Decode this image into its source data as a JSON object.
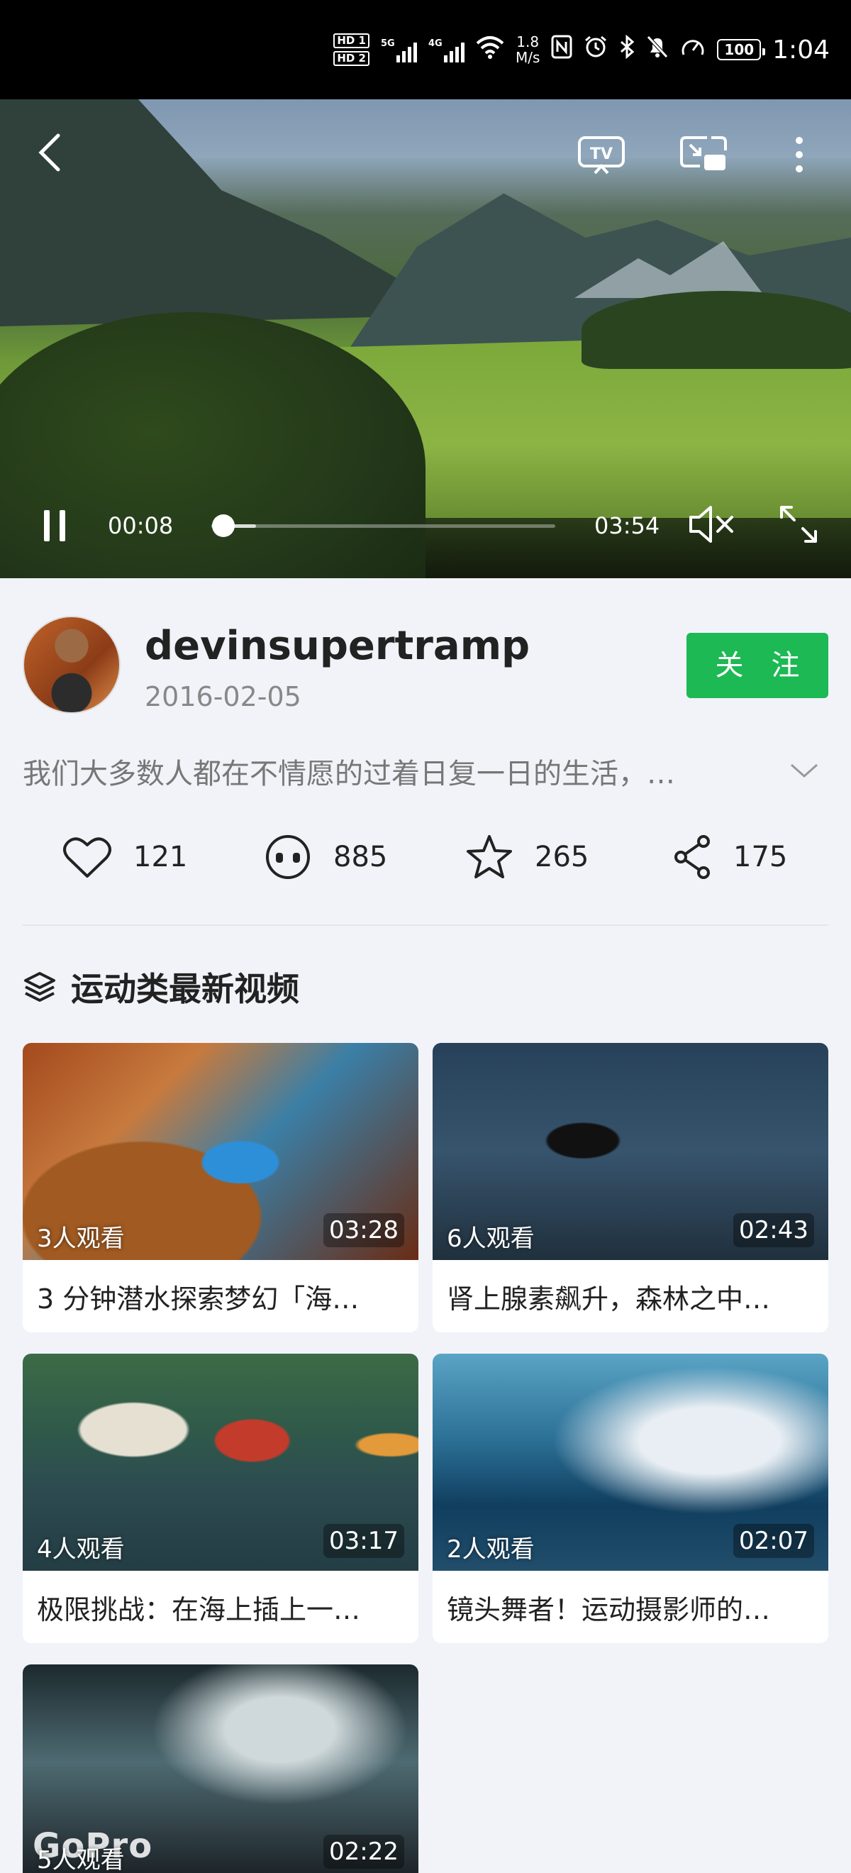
{
  "status_bar": {
    "hd_badges": [
      "HD 1",
      "HD 2"
    ],
    "network_labels": [
      "5G",
      "4G"
    ],
    "speed_value": "1.8",
    "speed_unit": "M/s",
    "battery": "100",
    "time": "1:04"
  },
  "player": {
    "current_time": "00:08",
    "duration": "03:54",
    "played_fraction": 0.035,
    "buffered_fraction": 0.13,
    "state": "playing",
    "muted": true,
    "accent_color": "#2ab6b0"
  },
  "author": {
    "name": "devinsupertramp",
    "date": "2016-02-05",
    "follow_label": "关 注",
    "follow_color": "#1db954"
  },
  "description": "我们大多数人都在不情愿的过着日复一日的生活，…",
  "stats": {
    "likes": "121",
    "comments": "885",
    "favorites": "265",
    "shares": "175"
  },
  "section": {
    "title": "运动类最新视频"
  },
  "videos": [
    {
      "viewers": "3人观看",
      "duration": "03:28",
      "title": "3 分钟潜水探索梦幻「海…"
    },
    {
      "viewers": "6人观看",
      "duration": "02:43",
      "title": "肾上腺素飙升，森林之中…"
    },
    {
      "viewers": "4人观看",
      "duration": "03:17",
      "title": "极限挑战：在海上插上一…"
    },
    {
      "viewers": "2人观看",
      "duration": "02:07",
      "title": "镜头舞者！运动摄影师的…"
    },
    {
      "viewers": "5人观看",
      "duration": "02:22",
      "title": "",
      "logo": "GoPro"
    }
  ]
}
